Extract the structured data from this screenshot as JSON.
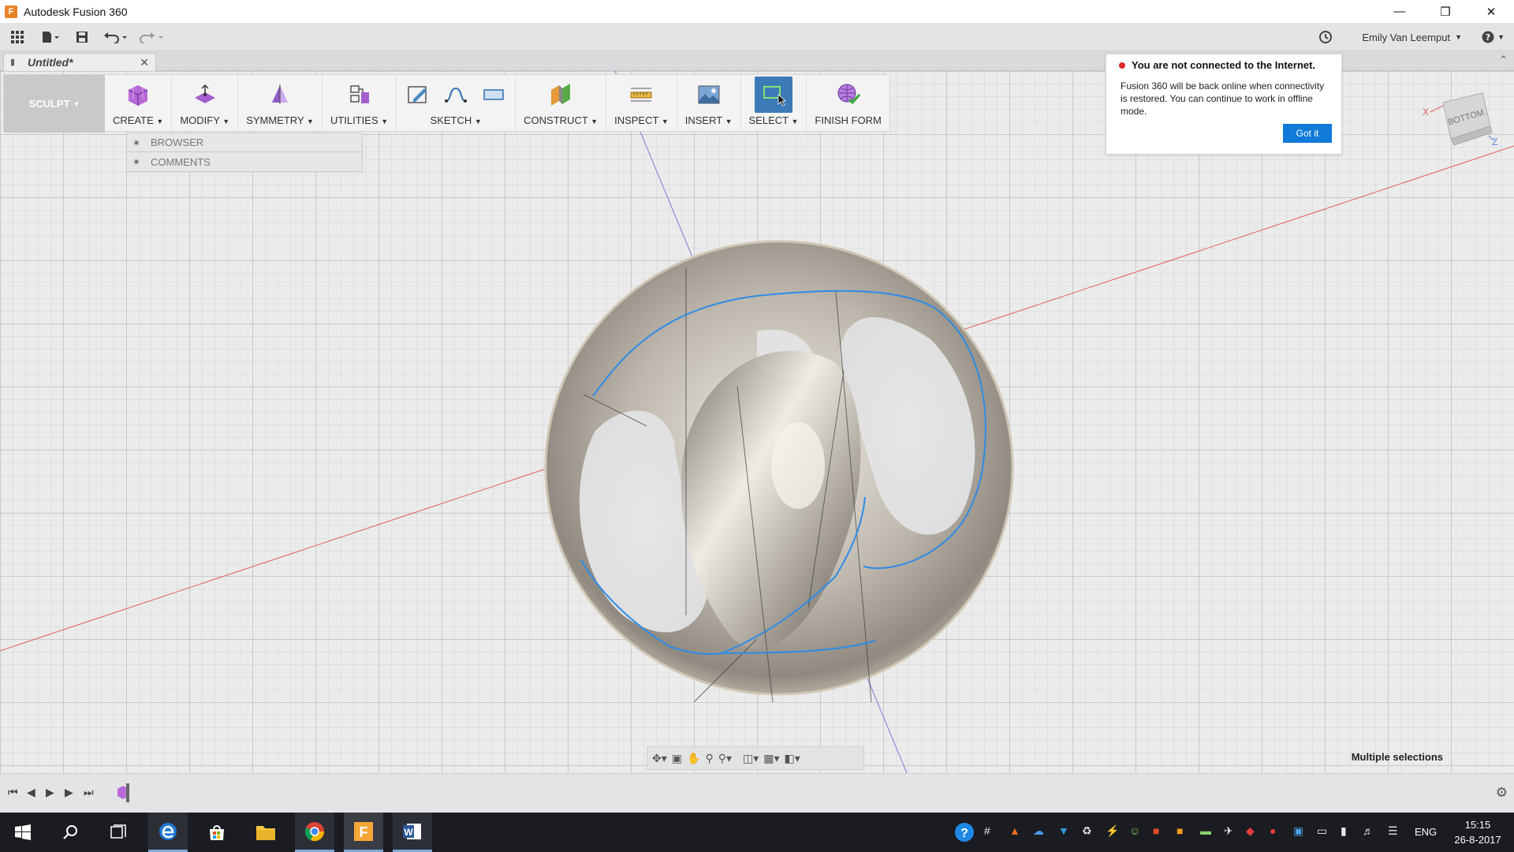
{
  "window": {
    "title": "Autodesk Fusion 360",
    "app_icon": "fusion-icon",
    "controls": [
      "minimize-icon",
      "restore-icon",
      "close-icon"
    ]
  },
  "appbar": {
    "user_name": "Emily Van Leemput",
    "icons": [
      "data-panel-icon",
      "file-icon",
      "save-icon",
      "undo-icon",
      "redo-icon",
      "job-status-icon",
      "help-icon"
    ]
  },
  "document_tab": {
    "label": "Untitled*"
  },
  "toolbar": {
    "workspace": "SCULPT",
    "groups": [
      {
        "label": "CREATE",
        "icon": "box-icon"
      },
      {
        "label": "MODIFY",
        "icon": "edit-form-icon"
      },
      {
        "label": "SYMMETRY",
        "icon": "mirror-icon"
      },
      {
        "label": "UTILITIES",
        "icon": "utilities-icon"
      },
      {
        "label": "SKETCH",
        "icons": [
          "sketch-icon",
          "spline-icon",
          "rectangle-icon"
        ]
      },
      {
        "label": "CONSTRUCT",
        "icon": "plane-icon"
      },
      {
        "label": "INSPECT",
        "icon": "measure-icon"
      },
      {
        "label": "INSERT",
        "icon": "image-icon"
      },
      {
        "label": "SELECT",
        "icon": "select-icon"
      },
      {
        "label": "FINISH FORM",
        "icon": "finish-form-icon"
      }
    ]
  },
  "browser": {
    "rows": [
      "BROWSER",
      "COMMENTS"
    ]
  },
  "notification": {
    "title": "You are not connected to the Internet.",
    "body": "Fusion 360 will be back online when connectivity is restored. You can continue to work in offline mode.",
    "button": "Got it"
  },
  "viewcube": {
    "face": "BOTTOM",
    "axis_x": "X",
    "axis_z": "Z"
  },
  "status": {
    "selection": "Multiple selections"
  },
  "taskbar": {
    "language": "ENG",
    "time": "15:15",
    "date": "26-8-2017"
  },
  "colors": {
    "accent": "#0f7ad8",
    "select_active": "#3d7ab8",
    "selection_edge": "#2f8be6",
    "red_axis": "#e06060",
    "blue_axis": "#7b7bd8"
  }
}
